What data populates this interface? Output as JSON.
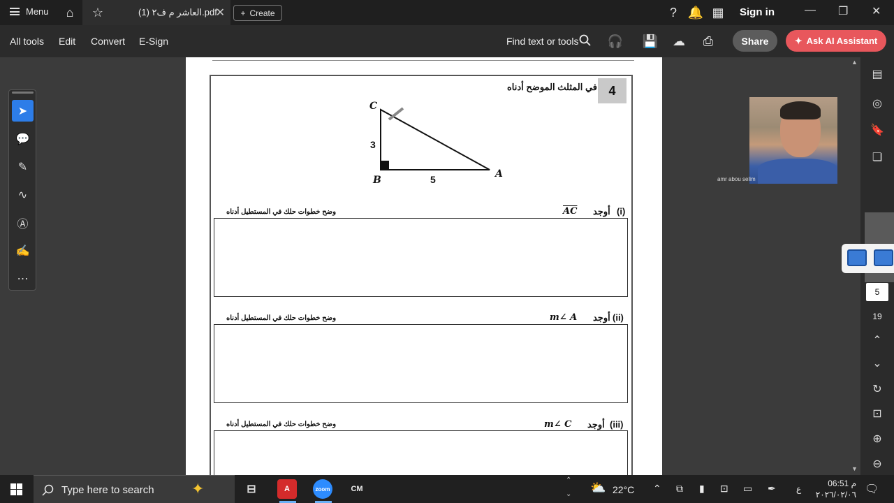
{
  "titlebar": {
    "menu_label": "Menu",
    "tab_title": "العاشر م ف٢ (1).pdf",
    "create_label": "Create",
    "signin_label": "Sign in"
  },
  "toolbar": {
    "items": [
      "All tools",
      "Edit",
      "Convert",
      "E-Sign"
    ],
    "find_label": "Find text or tools",
    "share_label": "Share",
    "ai_label": "Ask AI Assistant"
  },
  "document": {
    "question_number": "4",
    "question_text": "في المثلث الموضح أدناه",
    "triangle": {
      "vertex_c": "C",
      "vertex_b": "B",
      "vertex_a": "A",
      "side_bc": "3",
      "side_ba": "5"
    },
    "parts": [
      {
        "num": "(i)",
        "find": "أوجد",
        "target": "AC",
        "instruction": "وضح خطوات حلك في المستطيل أدناه"
      },
      {
        "num": "(ii)",
        "find": "أوجد",
        "target": "m∠ A",
        "instruction": "وضح خطوات حلك في المستطيل أدناه"
      },
      {
        "num": "(iii)",
        "find": "أوجد",
        "target": "m∠ C",
        "instruction": "وضح خطوات حلك في المستطيل أدناه"
      }
    ]
  },
  "video": {
    "participant_name": "amr abou selim"
  },
  "pages": {
    "current": "5",
    "total": "19"
  },
  "taskbar": {
    "search_placeholder": "Type here to search",
    "weather": "22°C",
    "lang": "ع",
    "time": "06:51 م",
    "date": "٢٠٢٦/٠٢/٠٦"
  }
}
